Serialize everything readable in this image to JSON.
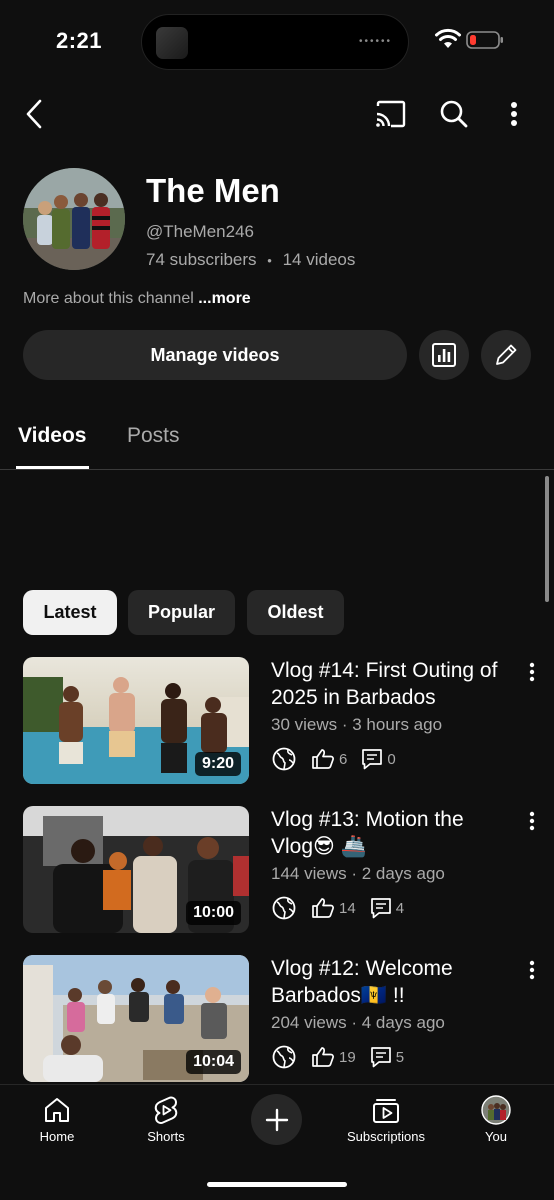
{
  "status_bar": {
    "time": "2:21",
    "island_dots": "••••••"
  },
  "topbar": {
    "icons": [
      "back-icon",
      "cast-icon",
      "search-icon",
      "more-vert-icon"
    ]
  },
  "channel": {
    "name": "The Men",
    "handle": "@TheMen246",
    "subscribers": "74 subscribers",
    "separator": "•",
    "videos": "14 videos",
    "about_text": "More about this channel",
    "about_more": "...more"
  },
  "actions": {
    "manage_label": "Manage videos",
    "analytics_icon": "analytics-icon",
    "edit_icon": "edit-pencil-icon"
  },
  "tabs": [
    {
      "label": "Videos",
      "active": true
    },
    {
      "label": "Posts",
      "active": false
    }
  ],
  "filters": [
    {
      "label": "Latest",
      "selected": true
    },
    {
      "label": "Popular",
      "selected": false
    },
    {
      "label": "Oldest",
      "selected": false
    }
  ],
  "videos": [
    {
      "title": "Vlog #14: First Outing of 2025 in Barbados",
      "meta": "30 views · 3 hours ago",
      "duration": "9:20",
      "likes": "6",
      "comments": "0"
    },
    {
      "title": "Vlog #13: Motion the Vlog😎 🚢",
      "meta": "144 views · 2 days ago",
      "duration": "10:00",
      "likes": "14",
      "comments": "4"
    },
    {
      "title": "Vlog #12: Welcome Barbados🇧🇧 !!",
      "meta": "204 views · 4 days ago",
      "duration": "10:04",
      "likes": "19",
      "comments": "5"
    }
  ],
  "bottom_nav": [
    {
      "label": "Home",
      "icon": "home-icon"
    },
    {
      "label": "Shorts",
      "icon": "shorts-icon"
    },
    {
      "label": "",
      "icon": "create-plus-icon"
    },
    {
      "label": "Subscriptions",
      "icon": "subscriptions-icon"
    },
    {
      "label": "You",
      "icon": "profile-avatar"
    }
  ],
  "colors": {
    "background": "#0f0f0f",
    "surface": "#272727",
    "secondary_text": "#aaaaaa",
    "chip_selected": "#f1f1f1"
  }
}
